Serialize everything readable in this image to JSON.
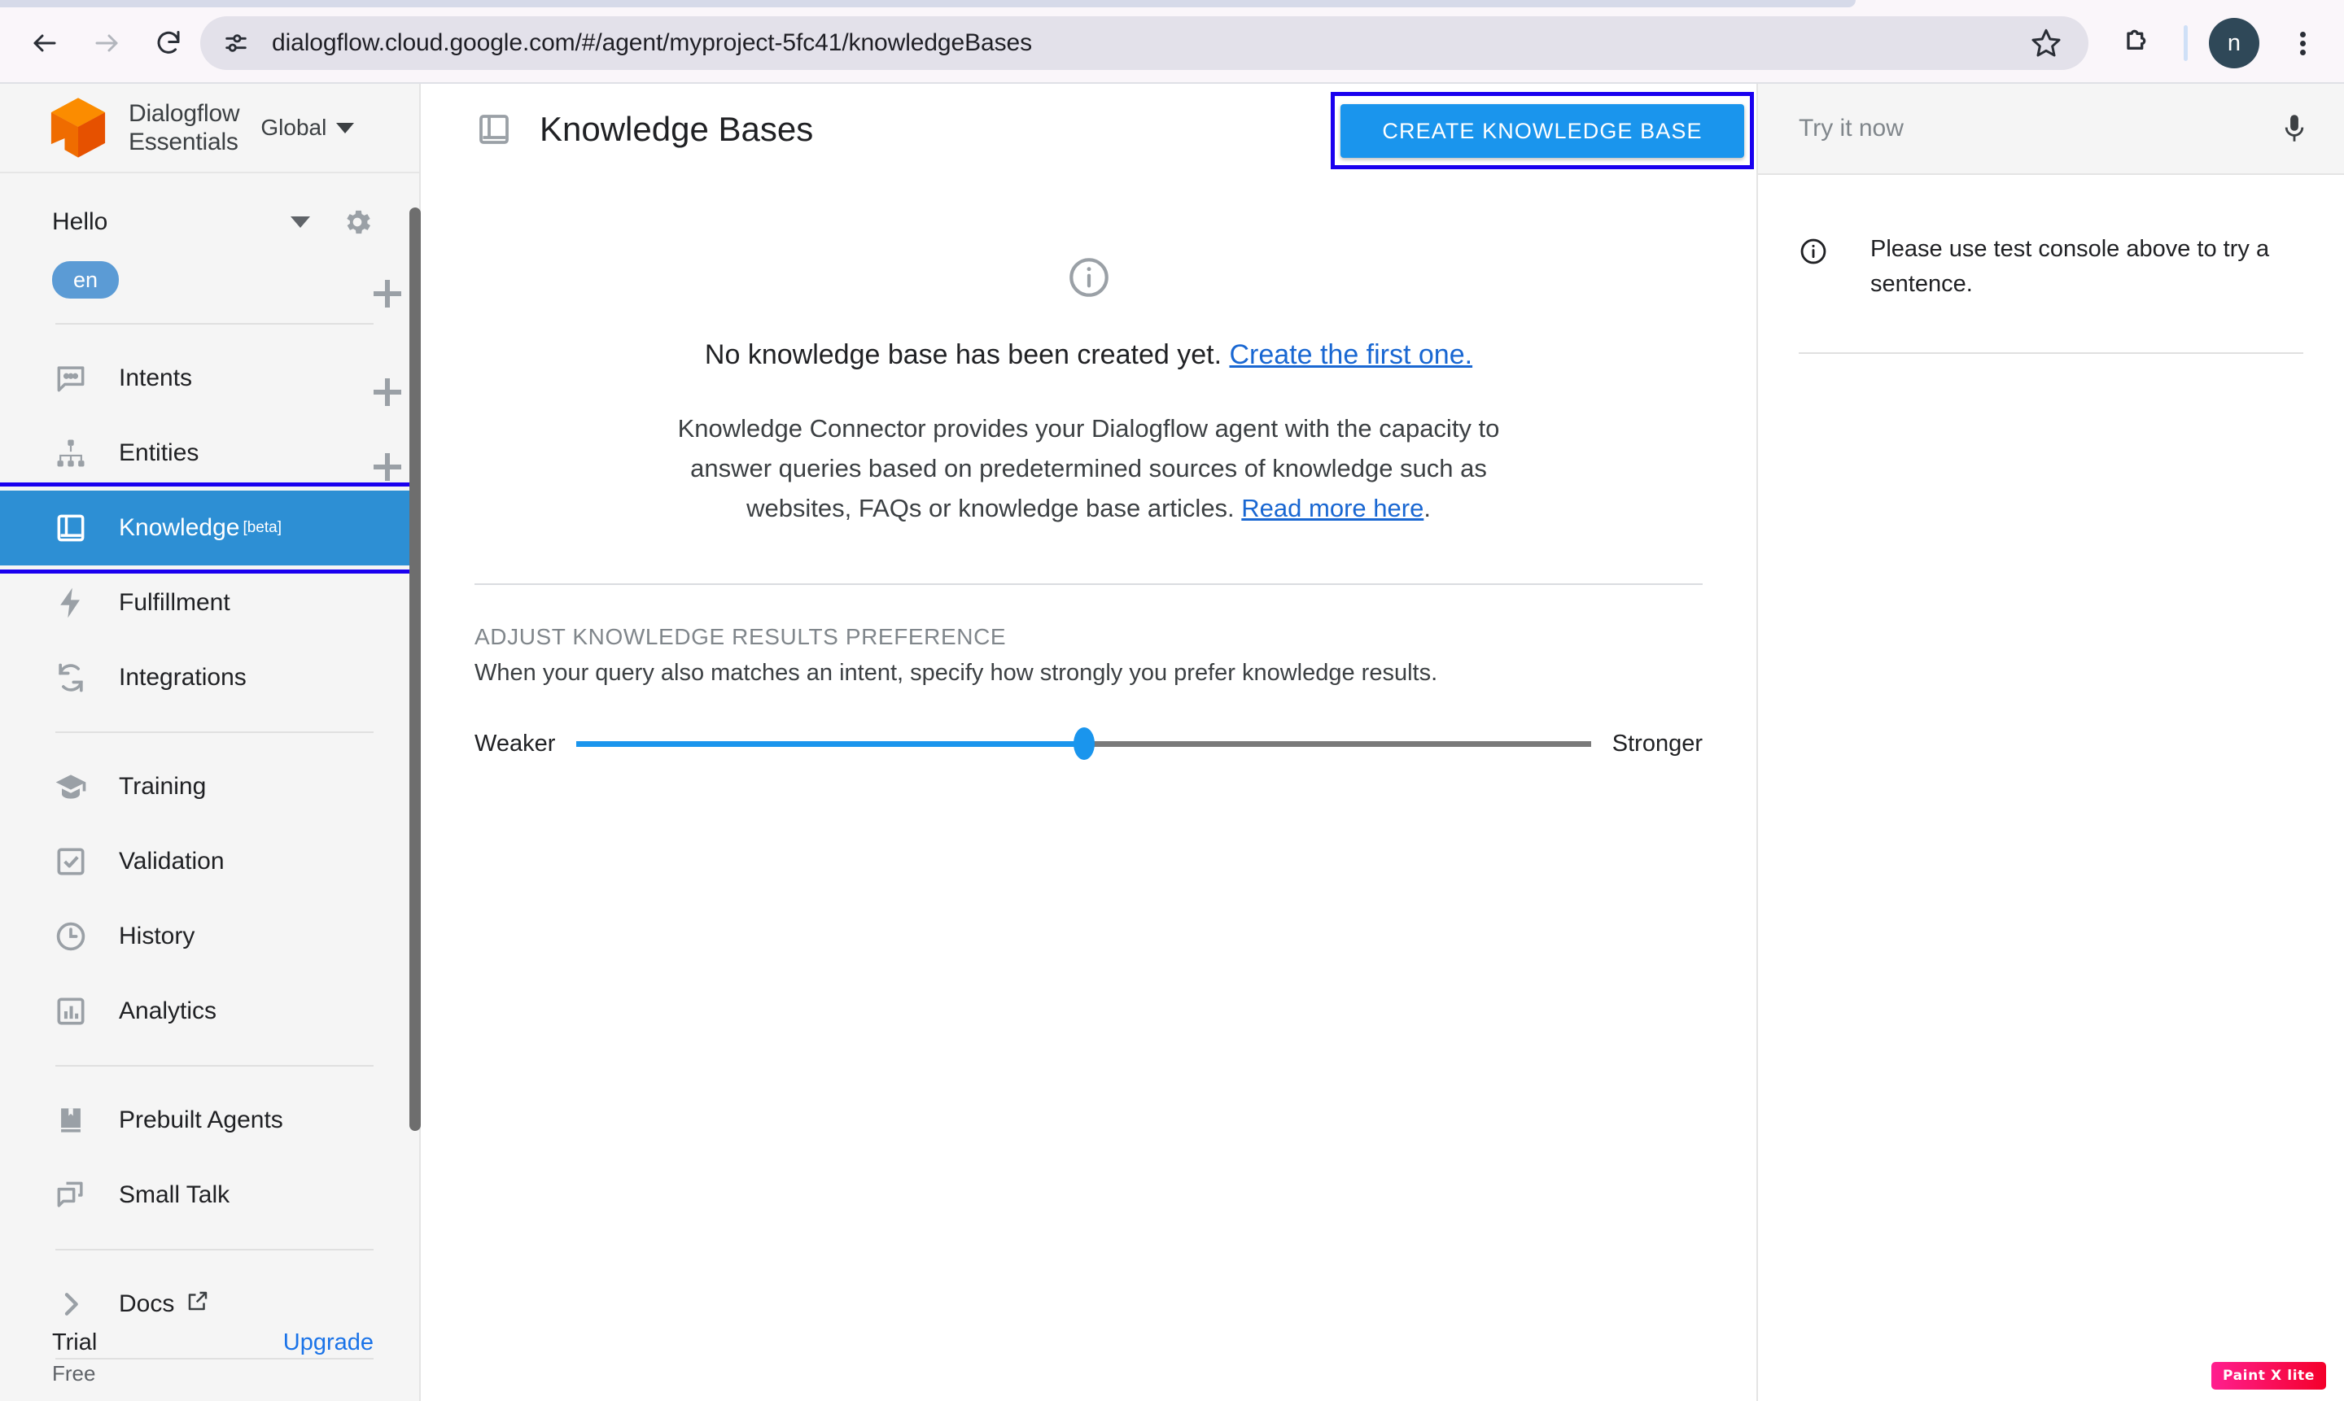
{
  "browser": {
    "url": "dialogflow.cloud.google.com/#/agent/myproject-5fc41/knowledgeBases",
    "back_label": "Back",
    "forward_label": "Forward",
    "reload_label": "Reload",
    "site_info_label": "View site information",
    "bookmark_label": "Bookmark this tab",
    "extensions_label": "Extensions",
    "profile_initial": "n",
    "menu_label": "Customize and control Chrome"
  },
  "sidebar": {
    "brand_line1": "Dialogflow",
    "brand_line2": "Essentials",
    "region": "Global",
    "agent_name": "Hello",
    "language_chip": "en",
    "items": [
      {
        "label": "Intents",
        "icon": "chat-bubble-icon",
        "has_plus": true
      },
      {
        "label": "Entities",
        "icon": "entity-tree-icon",
        "has_plus": true
      },
      {
        "label": "Knowledge",
        "badge": "[beta]",
        "icon": "book-icon",
        "has_plus": false,
        "selected": true
      },
      {
        "label": "Fulfillment",
        "icon": "bolt-icon",
        "has_plus": false
      },
      {
        "label": "Integrations",
        "icon": "sync-icon",
        "has_plus": false
      },
      {
        "label": "Training",
        "icon": "graduation-cap-icon",
        "has_plus": false
      },
      {
        "label": "Validation",
        "icon": "checkbox-icon",
        "has_plus": false
      },
      {
        "label": "History",
        "icon": "clock-icon",
        "has_plus": false
      },
      {
        "label": "Analytics",
        "icon": "bar-chart-icon",
        "has_plus": false
      },
      {
        "label": "Prebuilt Agents",
        "icon": "bookmark-book-icon",
        "has_plus": false
      },
      {
        "label": "Small Talk",
        "icon": "speech-bubbles-icon",
        "has_plus": false
      },
      {
        "label": "Docs",
        "icon": "chevron-right-icon",
        "external": true,
        "has_plus": false
      }
    ],
    "trial_title": "Trial",
    "trial_sub": "Free",
    "upgrade_label": "Upgrade"
  },
  "main": {
    "title": "Knowledge Bases",
    "create_button": "CREATE KNOWLEDGE BASE",
    "empty_text": "No knowledge base has been created yet.",
    "empty_link": "Create the first one.",
    "description_part1": "Knowledge Connector provides your Dialogflow agent with the capacity to answer queries based on predetermined sources of knowledge such as websites, FAQs or knowledge base articles. ",
    "description_link": "Read more here",
    "description_part2": ".",
    "pref_heading": "ADJUST KNOWLEDGE RESULTS PREFERENCE",
    "pref_desc": "When your query also matches an intent, specify how strongly you prefer knowledge results.",
    "slider_min_label": "Weaker",
    "slider_max_label": "Stronger",
    "slider_value_percent": 50
  },
  "right_panel": {
    "try_placeholder": "Try it now",
    "mic_label": "Use microphone",
    "message": "Please use test console above to try a sentence."
  },
  "watermark": {
    "label": "Paint X lite"
  },
  "colors": {
    "accent_blue": "#1a95ed",
    "selected_nav": "#2d8fd4",
    "annotation_outline": "#1a00ef",
    "link_blue": "#1967d2",
    "brand_orange": "#ef6c00"
  }
}
